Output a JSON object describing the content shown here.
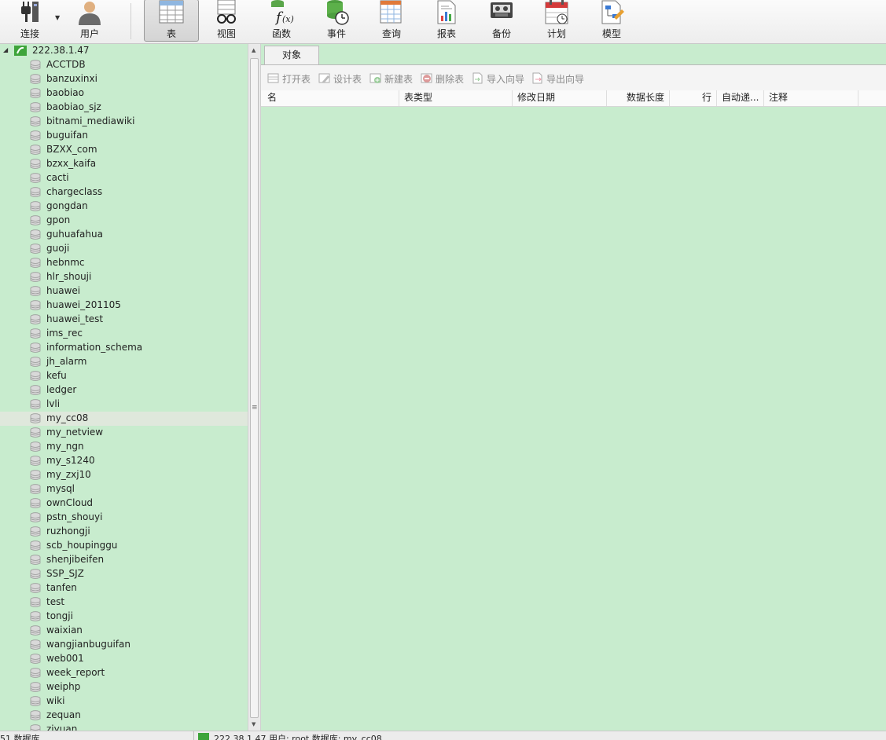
{
  "toolbar": {
    "buttons": [
      {
        "label": "连接",
        "icon": "connection-plug-icon"
      },
      {
        "label": "用户",
        "icon": "user-icon"
      },
      {
        "label": "表",
        "icon": "table-icon"
      },
      {
        "label": "视图",
        "icon": "view-glasses-icon"
      },
      {
        "label": "函数",
        "icon": "function-fx-icon"
      },
      {
        "label": "事件",
        "icon": "event-clock-icon"
      },
      {
        "label": "查询",
        "icon": "query-grid-icon"
      },
      {
        "label": "报表",
        "icon": "report-icon"
      },
      {
        "label": "备份",
        "icon": "backup-tape-icon"
      },
      {
        "label": "计划",
        "icon": "schedule-calendar-icon"
      },
      {
        "label": "模型",
        "icon": "model-diagram-icon"
      }
    ],
    "active": "表"
  },
  "tree": {
    "connection": "222.38.1.47",
    "databases": [
      "ACCTDB",
      "banzuxinxi",
      "baobiao",
      "baobiao_sjz",
      "bitnami_mediawiki",
      "buguifan",
      "BZXX_com",
      "bzxx_kaifa",
      "cacti",
      "chargeclass",
      "gongdan",
      "gpon",
      "guhuafahua",
      "guoji",
      "hebnmc",
      "hlr_shouji",
      "huawei",
      "huawei_201105",
      "huawei_test",
      "ims_rec",
      "information_schema",
      "jh_alarm",
      "kefu",
      "ledger",
      "lvli",
      "my_cc08",
      "my_netview",
      "my_ngn",
      "my_s1240",
      "my_zxj10",
      "mysql",
      "ownCloud",
      "pstn_shouyi",
      "ruzhongji",
      "scb_houpinggu",
      "shenjibeifen",
      "SSP_SJZ",
      "tanfen",
      "test",
      "tongji",
      "waixian",
      "wangjianbuguifan",
      "web001",
      "week_report",
      "weiphp",
      "wiki",
      "zequan",
      "ziyuan"
    ],
    "selected": "my_cc08"
  },
  "objects": {
    "tab": "对象",
    "actions": [
      "打开表",
      "设计表",
      "新建表",
      "删除表",
      "导入向导",
      "导出向导"
    ],
    "columns": [
      "名",
      "表类型",
      "修改日期",
      "数据长度",
      "行",
      "自动递...",
      "注释"
    ]
  },
  "status": {
    "left": "51 数据库",
    "right": "222.38.1.47   用户: root   数据库: my_cc08"
  },
  "colors": {
    "background": "#c8ecce",
    "toolbar": "#f2f2f2",
    "connection_green": "#3ea43b"
  }
}
